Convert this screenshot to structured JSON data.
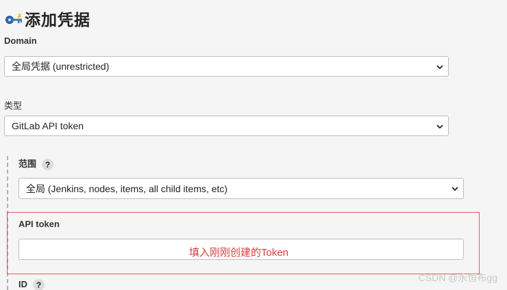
{
  "header": {
    "title": "添加凭据",
    "icon": "key-icon"
  },
  "domain": {
    "label": "Domain",
    "selected": "全局凭据 (unrestricted)"
  },
  "kind": {
    "label": "类型",
    "selected": "GitLab API token"
  },
  "scope": {
    "label": "范围",
    "help": "?",
    "selected": "全局 (Jenkins, nodes, items, all child items, etc)"
  },
  "api_token": {
    "label": "API token",
    "value": "",
    "annotation": "填入刚刚创建的Token"
  },
  "id_field": {
    "label": "ID",
    "help": "?"
  },
  "watermark": "CSDN @永恒布gg",
  "colors": {
    "annotation_red": "#e23b3b",
    "highlight_border": "#e05a5a",
    "background": "#f5f5f5"
  }
}
